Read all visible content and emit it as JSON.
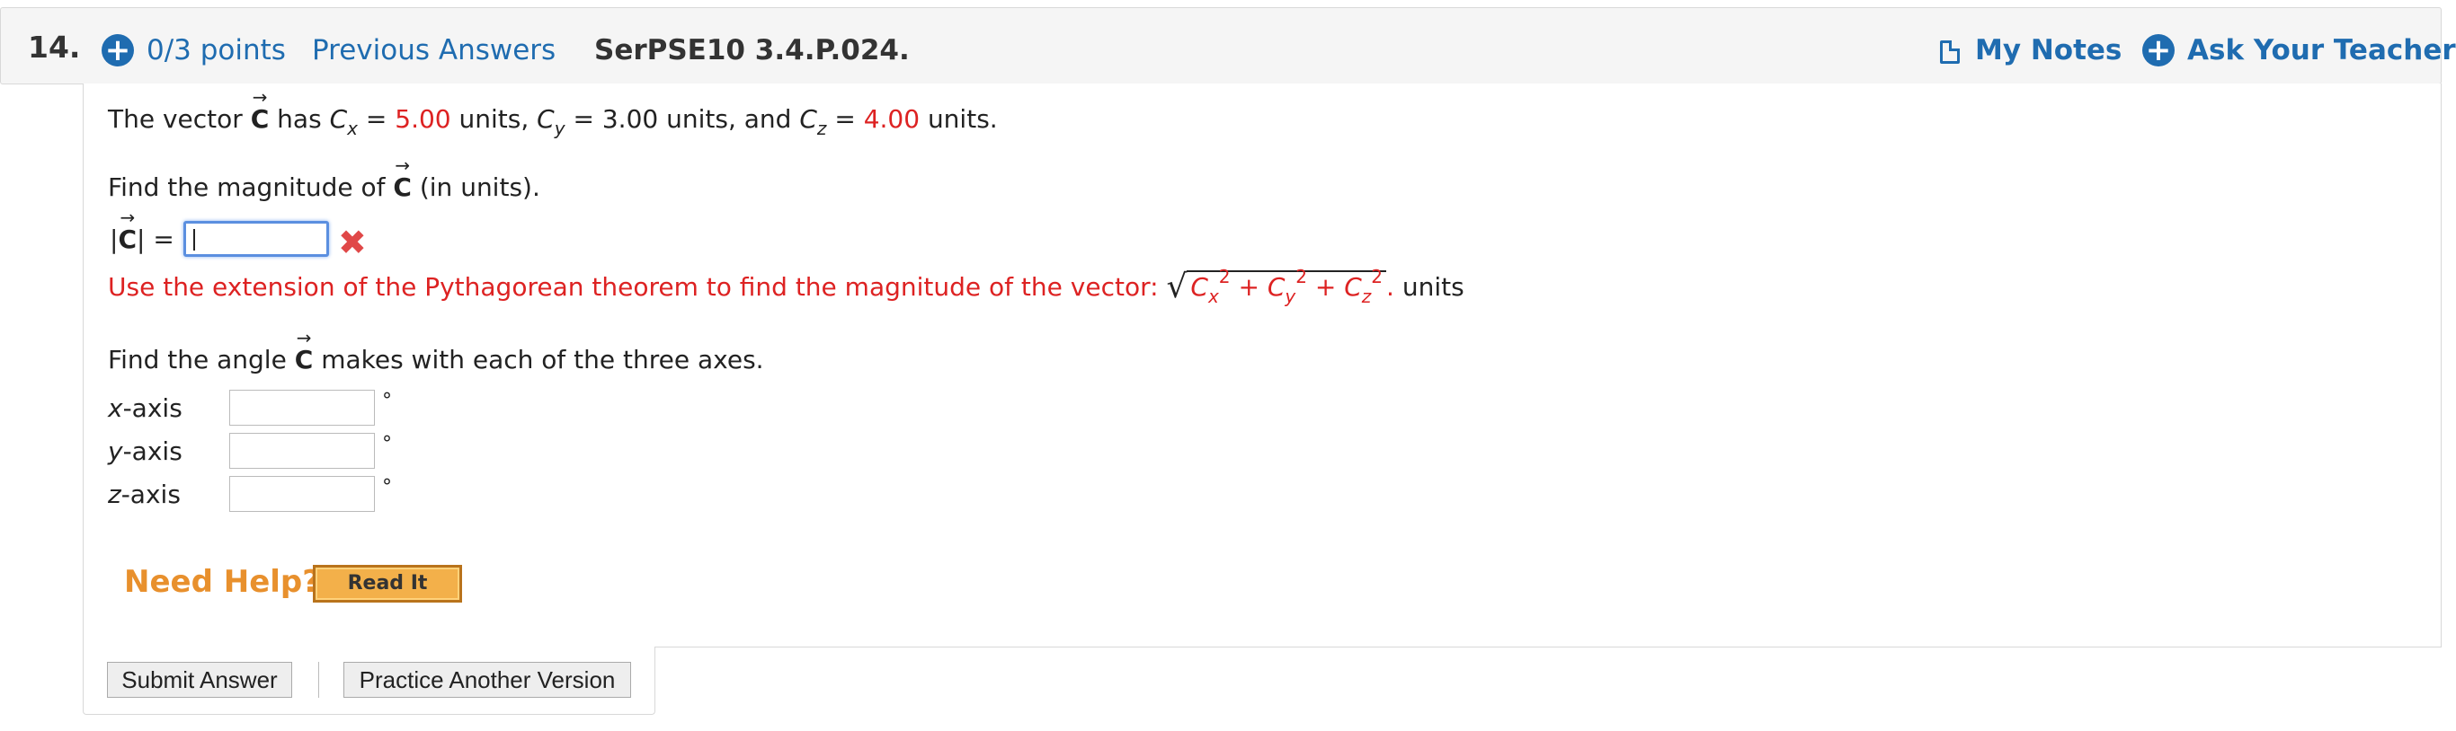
{
  "header": {
    "question_number": "14.",
    "points": "0/3 points",
    "previous_answers": "Previous Answers",
    "assignment_id": "SerPSE10 3.4.P.024.",
    "my_notes": "My Notes",
    "ask_teacher": "Ask Your Teacher"
  },
  "problem": {
    "intro_prefix": "The vector",
    "vector_symbol": "C",
    "has": "has",
    "cx_label": "C",
    "cx_sub": "x",
    "cx_value": "5.00",
    "cy_label": "C",
    "cy_sub": "y",
    "cy_value": "3.00",
    "cz_label": "C",
    "cz_sub": "z",
    "cz_value": "4.00",
    "units_comma": "units,",
    "units_and": "units, and",
    "units_end": "units.",
    "equals": "="
  },
  "magnitude": {
    "prompt_prefix": "Find the magnitude of",
    "prompt_suffix": "(in units).",
    "label_open": "|",
    "label_close": "| =",
    "input_value": "",
    "feedback": "Use the extension of the Pythagorean theorem to find the magnitude of the vector:",
    "formula_c": "C",
    "formula_x": "x",
    "formula_y": "y",
    "formula_z": "z",
    "formula_exp": "2",
    "formula_plus": "+",
    "formula_period": ".",
    "units": "units"
  },
  "angles": {
    "prompt_prefix": "Find the angle",
    "prompt_suffix": "makes with each of the three axes.",
    "rows": [
      {
        "axis": "x",
        "suffix": "-axis",
        "value": "",
        "unit": "°"
      },
      {
        "axis": "y",
        "suffix": "-axis",
        "value": "",
        "unit": "°"
      },
      {
        "axis": "z",
        "suffix": "-axis",
        "value": "",
        "unit": "°"
      }
    ]
  },
  "help": {
    "need_help": "Need Help?",
    "read_it": "Read It"
  },
  "actions": {
    "submit": "Submit Answer",
    "practice": "Practice Another Version"
  },
  "colors": {
    "link_blue": "#1f6cb0",
    "given_red": "#dd2222",
    "help_orange": "#e8902d"
  }
}
